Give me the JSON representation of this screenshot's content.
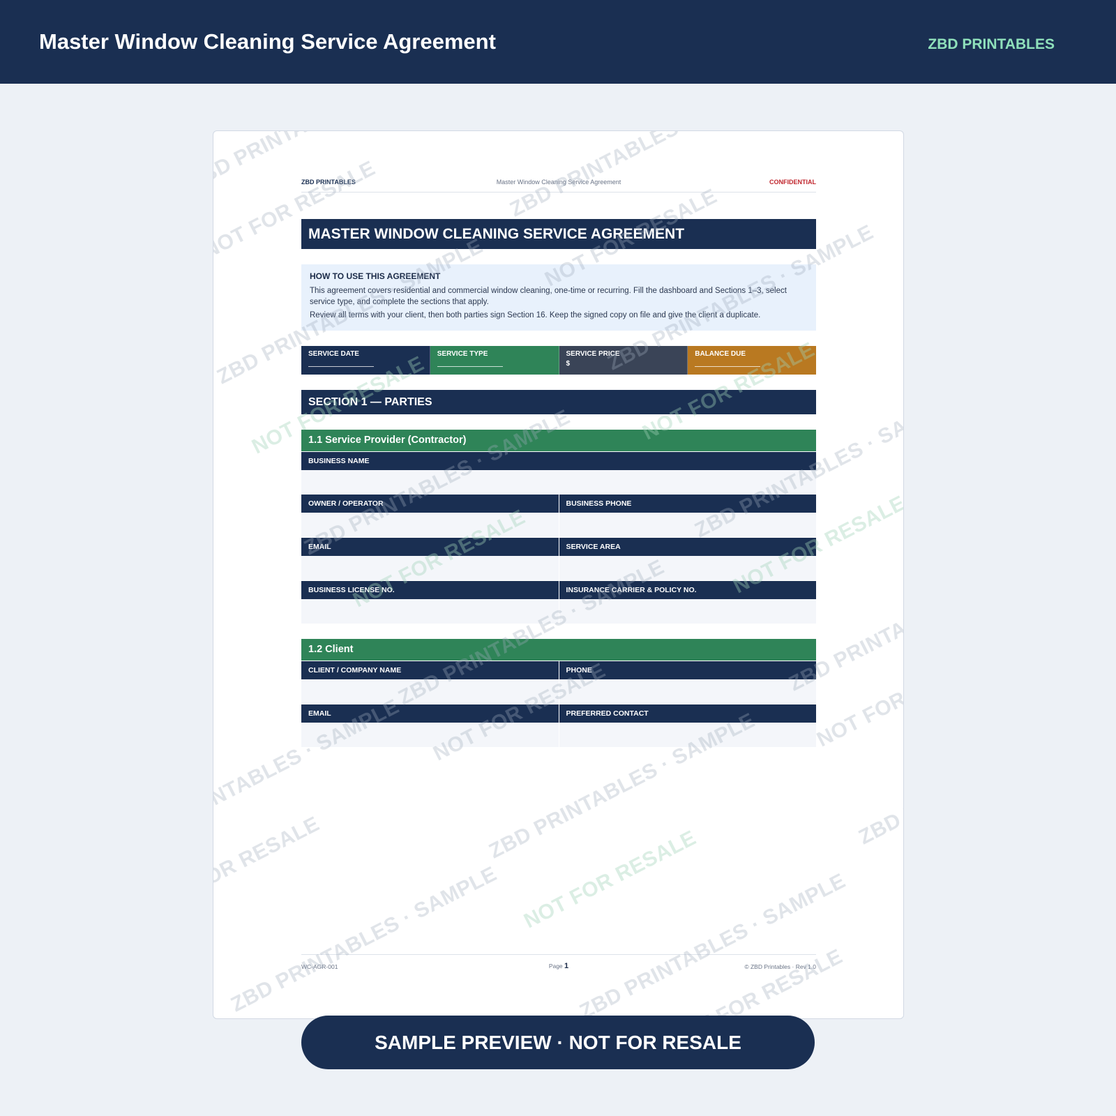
{
  "app": {
    "title": "Master Window Cleaning Service Agreement",
    "brand": "ZBD PRINTABLES"
  },
  "document": {
    "running_header": {
      "brand": "ZBD PRINTABLES",
      "title": "Master Window Cleaning Service Agreement",
      "confidential": "CONFIDENTIAL"
    },
    "main_title": "MASTER WINDOW CLEANING SERVICE AGREEMENT",
    "how_to": {
      "heading": "HOW TO USE THIS AGREEMENT",
      "paragraph_1": "This agreement covers residential and commercial window cleaning, one-time or recurring. Fill the dashboard and Sections 1–3, select service type, and complete the sections that apply.",
      "paragraph_2": "Review all terms with your client, then both parties sign Section 16. Keep the signed copy on file and give the client a duplicate."
    },
    "dashboard": [
      {
        "label": "SERVICE DATE",
        "color": "#1a2f52"
      },
      {
        "label": "SERVICE TYPE",
        "color": "#2f8458"
      },
      {
        "label": "SERVICE PRICE",
        "value": "$",
        "color": "#3a4457"
      },
      {
        "label": "BALANCE DUE",
        "color": "#b97921"
      }
    ],
    "section_1": {
      "title": "SECTION 1 — PARTIES",
      "provider": {
        "title": "1.1  Service Provider (Contractor)",
        "business_name": "BUSINESS NAME",
        "owner": "OWNER / OPERATOR",
        "business_phone": "BUSINESS PHONE",
        "email": "EMAIL",
        "service_area": "SERVICE AREA",
        "license": "BUSINESS LICENSE NO.",
        "insurance": "INSURANCE CARRIER & POLICY NO."
      },
      "client": {
        "title": "1.2  Client",
        "company_name": "CLIENT / COMPANY NAME",
        "phone": "PHONE",
        "email": "EMAIL",
        "preferred_contact": "PREFERRED CONTACT"
      }
    },
    "footer": {
      "doc_code": "WC-AGR-001",
      "page_label": "Page",
      "page_number": "1",
      "copyright": "© ZBD Printables  ·  Rev 1.0"
    }
  },
  "watermarks": {
    "brand_sample": "ZBD PRINTABLES · SAMPLE",
    "not_for_resale": "NOT FOR RESALE"
  },
  "banner": "SAMPLE PREVIEW · NOT FOR RESALE",
  "colors": {
    "navy": "#1a2f52",
    "green": "#2f8458",
    "slate": "#3a4457",
    "amber": "#b97921",
    "confidential_red": "#c0262d",
    "brand_mint": "#8fe0bb"
  }
}
